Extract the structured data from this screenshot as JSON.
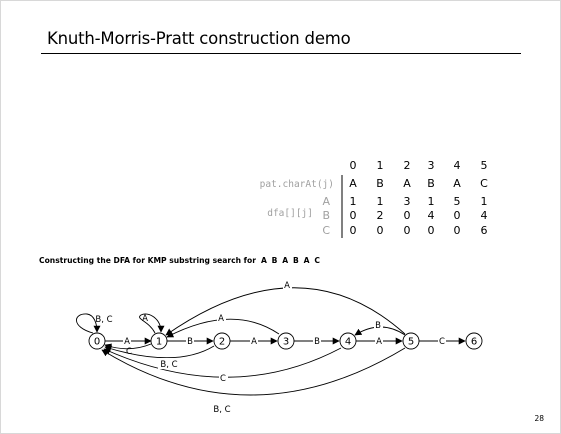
{
  "slide": {
    "title": "Knuth-Morris-Pratt construction demo",
    "page_number": "28"
  },
  "caption": {
    "text": "Constructing the DFA for KMP substring search for",
    "pattern": "A B A B A C"
  },
  "table": {
    "columns": [
      "0",
      "1",
      "2",
      "3",
      "4",
      "5"
    ],
    "pat_label": "pat.charAt(j)",
    "pat_row": [
      "A",
      "B",
      "A",
      "B",
      "A",
      "C"
    ],
    "dfa_label": "dfa[][j]",
    "rows": [
      {
        "char": "A",
        "values": [
          "1",
          "1",
          "3",
          "1",
          "5",
          "1"
        ]
      },
      {
        "char": "B",
        "values": [
          "0",
          "2",
          "0",
          "4",
          "0",
          "4"
        ]
      },
      {
        "char": "C",
        "values": [
          "0",
          "0",
          "0",
          "0",
          "0",
          "6"
        ]
      }
    ]
  },
  "diagram": {
    "states": [
      "0",
      "1",
      "2",
      "3",
      "4",
      "5",
      "6"
    ],
    "edge_labels": {
      "e0_1": "A",
      "e1_2": "B",
      "e2_3": "A",
      "e3_4": "B",
      "e4_5": "A",
      "e5_6": "C",
      "loop0": "B, C",
      "loop1": "A",
      "e1_0": "C",
      "e2_0": "B, C",
      "e3_1": "A",
      "e4_0": "C",
      "e5_1": "A",
      "e5_4": "B",
      "e5_0": "B, C"
    }
  },
  "colors": {
    "text": "#000000",
    "label_gray": "#a0a0a0"
  }
}
